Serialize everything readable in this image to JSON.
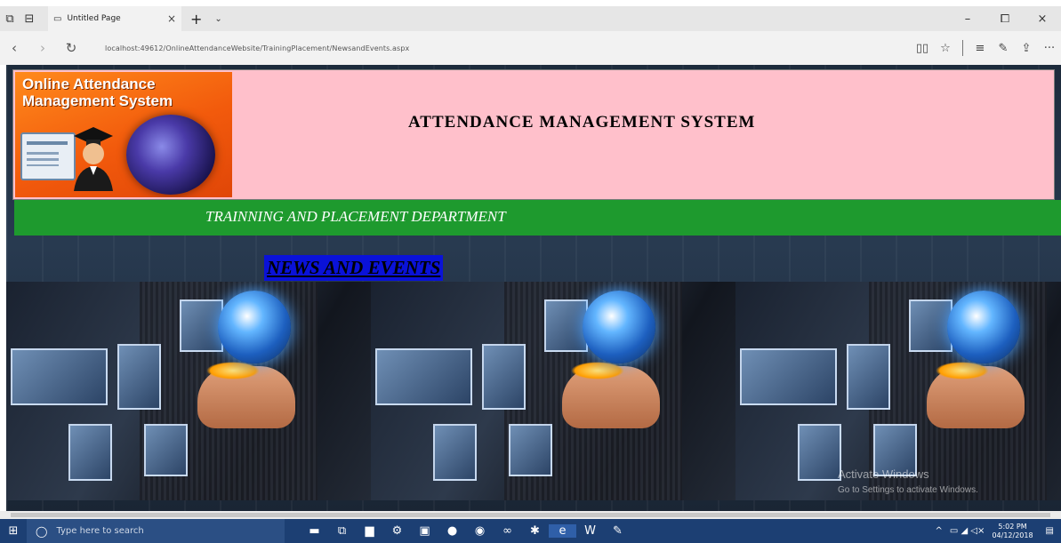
{
  "browser": {
    "tab_title": "Untitled Page",
    "tab_close": "×",
    "new_tab": "+",
    "tab_menu": "⌄",
    "url": "localhost:49612/OnlineAttendanceWebsite/TrainingPlacement/NewsandEvents.aspx",
    "window_controls": [
      "–",
      "⧠",
      "×"
    ],
    "nav": {
      "back": "‹",
      "forward": "›",
      "refresh": "↻"
    },
    "tools": {
      "reading": "▯▯",
      "favorite": "☆",
      "hub": "≡",
      "notes": "✎",
      "share": "⇪",
      "more": "···"
    }
  },
  "page": {
    "logo_text": "Online Attendance Management System",
    "title": "ATTENDANCE MANAGEMENT SYSTEM",
    "department": "TRAINNING AND PLACEMENT DEPARTMENT",
    "news_link": "NEWS AND EVENTS",
    "colors": {
      "header_bg": "#ffc0cb",
      "dept_bar": "#1e9a2e",
      "news_bg": "#0a12d8",
      "logo_bg": "#f25a0c"
    }
  },
  "watermark": {
    "line1": "Activate Windows",
    "line2": "Go to Settings to activate Windows."
  },
  "taskbar": {
    "start_icon": "⊞",
    "search_placeholder": "Type here to search",
    "search_icon": "◯",
    "apps": [
      "windows-ink-icon",
      "task-view-icon",
      "file-explorer-icon",
      "settings-icon",
      "store-icon",
      "firefox-icon",
      "whatsapp-icon",
      "media-icon",
      "game-icon",
      "edge-icon",
      "word-icon",
      "paint-icon"
    ],
    "tray_chevron": "^",
    "tray_icons": "▭ ◢ ◁×",
    "time": "5:02 PM",
    "date": "04/12/2018",
    "notification_icon": "▤"
  }
}
